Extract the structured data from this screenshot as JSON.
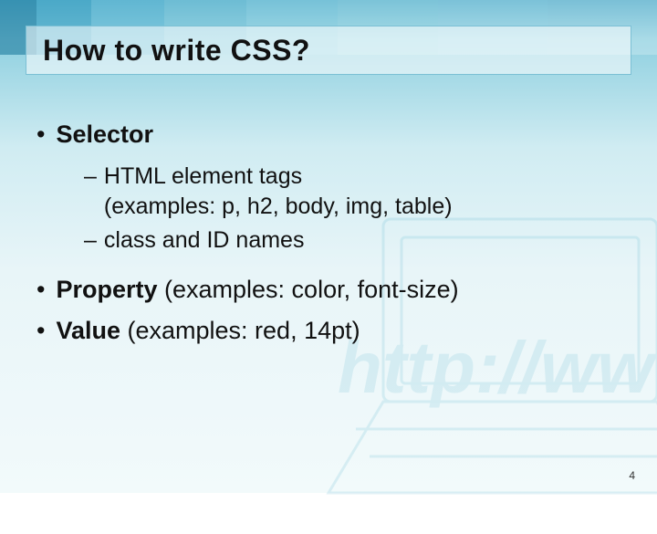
{
  "slide": {
    "title": "How to write CSS?",
    "bullets": [
      {
        "label": "Selector",
        "rest": "",
        "sub": [
          "HTML element tags\n(examples: p, h2, body, img, table)",
          "class and ID names"
        ]
      },
      {
        "label": "Property",
        "rest": " (examples: color, font-size)",
        "sub": []
      },
      {
        "label": "Value",
        "rest": " (examples: red, 14pt)",
        "sub": []
      }
    ],
    "page_number": "4"
  }
}
